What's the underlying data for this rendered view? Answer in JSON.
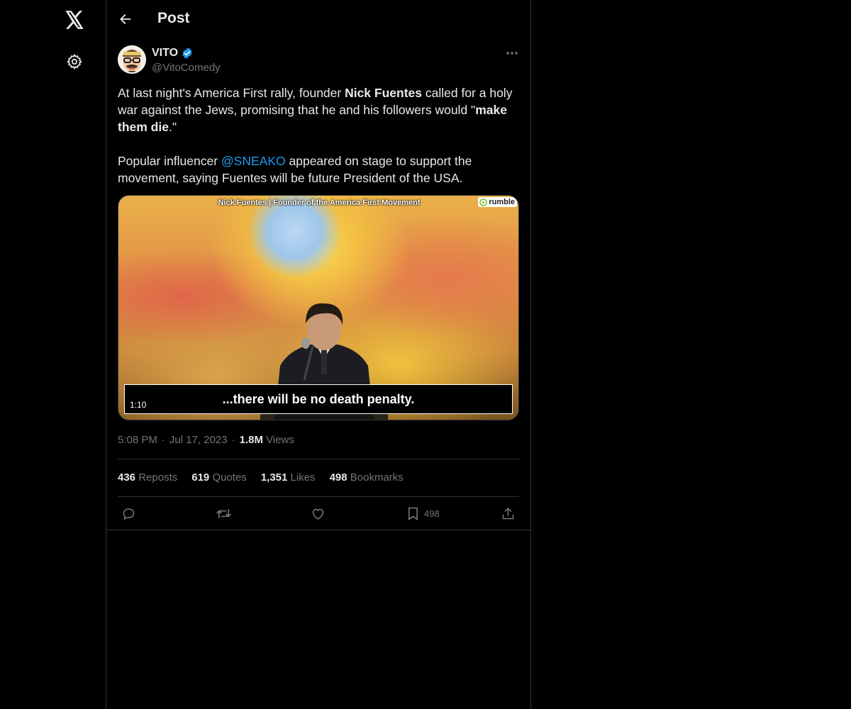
{
  "nav": {
    "logo_icon": "x-logo-icon",
    "settings_icon": "gear-icon"
  },
  "header": {
    "title": "Post",
    "back_icon": "arrow-left-icon"
  },
  "post": {
    "author": {
      "name": "VITO",
      "handle": "@VitoComedy",
      "verified": true,
      "verified_color": "#1d9bf0"
    },
    "text": {
      "p1_a": "At last night's America First rally, founder ",
      "p1_b": "Nick Fuentes",
      "p1_c": " called for a holy war against the Jews, promising that he and his followers would \"",
      "p1_d": "make them die",
      "p1_e": ".\"",
      "p2_a": "Popular influencer ",
      "p2_mention": "@SNEAKO",
      "p2_b": " appeared on stage to support the movement, saying Fuentes will be future President of the USA."
    },
    "video": {
      "caption_top": "Nick Fuentes | Founder of the America First Movement",
      "brand": "rumble",
      "subtitle": "...there will be no death penalty.",
      "duration": "1:10"
    },
    "meta": {
      "time": "5:08 PM",
      "date": "Jul 17, 2023",
      "views_count": "1.8M",
      "views_label": "Views"
    },
    "stats": {
      "reposts_count": "436",
      "reposts_label": "Reposts",
      "quotes_count": "619",
      "quotes_label": "Quotes",
      "likes_count": "1,351",
      "likes_label": "Likes",
      "bookmarks_count": "498",
      "bookmarks_label": "Bookmarks"
    },
    "actions": {
      "bookmark_count": "498"
    }
  },
  "colors": {
    "background": "#000000",
    "text": "#e7e9ea",
    "muted": "#71767b",
    "accent": "#1d9bf0",
    "border": "#2f3336"
  }
}
